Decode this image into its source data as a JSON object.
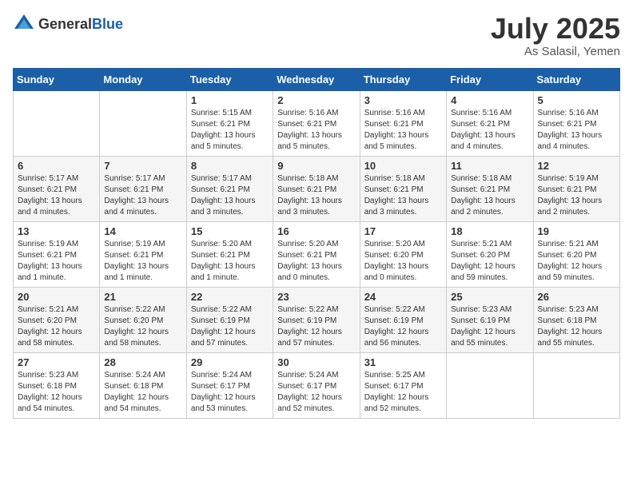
{
  "logo": {
    "general": "General",
    "blue": "Blue"
  },
  "header": {
    "month": "July 2025",
    "location": "As Salasil, Yemen"
  },
  "weekdays": [
    "Sunday",
    "Monday",
    "Tuesday",
    "Wednesday",
    "Thursday",
    "Friday",
    "Saturday"
  ],
  "weeks": [
    [
      null,
      null,
      {
        "day": "1",
        "sunrise": "Sunrise: 5:15 AM",
        "sunset": "Sunset: 6:21 PM",
        "daylight": "Daylight: 13 hours and 5 minutes."
      },
      {
        "day": "2",
        "sunrise": "Sunrise: 5:16 AM",
        "sunset": "Sunset: 6:21 PM",
        "daylight": "Daylight: 13 hours and 5 minutes."
      },
      {
        "day": "3",
        "sunrise": "Sunrise: 5:16 AM",
        "sunset": "Sunset: 6:21 PM",
        "daylight": "Daylight: 13 hours and 5 minutes."
      },
      {
        "day": "4",
        "sunrise": "Sunrise: 5:16 AM",
        "sunset": "Sunset: 6:21 PM",
        "daylight": "Daylight: 13 hours and 4 minutes."
      },
      {
        "day": "5",
        "sunrise": "Sunrise: 5:16 AM",
        "sunset": "Sunset: 6:21 PM",
        "daylight": "Daylight: 13 hours and 4 minutes."
      }
    ],
    [
      {
        "day": "6",
        "sunrise": "Sunrise: 5:17 AM",
        "sunset": "Sunset: 6:21 PM",
        "daylight": "Daylight: 13 hours and 4 minutes."
      },
      {
        "day": "7",
        "sunrise": "Sunrise: 5:17 AM",
        "sunset": "Sunset: 6:21 PM",
        "daylight": "Daylight: 13 hours and 4 minutes."
      },
      {
        "day": "8",
        "sunrise": "Sunrise: 5:17 AM",
        "sunset": "Sunset: 6:21 PM",
        "daylight": "Daylight: 13 hours and 3 minutes."
      },
      {
        "day": "9",
        "sunrise": "Sunrise: 5:18 AM",
        "sunset": "Sunset: 6:21 PM",
        "daylight": "Daylight: 13 hours and 3 minutes."
      },
      {
        "day": "10",
        "sunrise": "Sunrise: 5:18 AM",
        "sunset": "Sunset: 6:21 PM",
        "daylight": "Daylight: 13 hours and 3 minutes."
      },
      {
        "day": "11",
        "sunrise": "Sunrise: 5:18 AM",
        "sunset": "Sunset: 6:21 PM",
        "daylight": "Daylight: 13 hours and 2 minutes."
      },
      {
        "day": "12",
        "sunrise": "Sunrise: 5:19 AM",
        "sunset": "Sunset: 6:21 PM",
        "daylight": "Daylight: 13 hours and 2 minutes."
      }
    ],
    [
      {
        "day": "13",
        "sunrise": "Sunrise: 5:19 AM",
        "sunset": "Sunset: 6:21 PM",
        "daylight": "Daylight: 13 hours and 1 minute."
      },
      {
        "day": "14",
        "sunrise": "Sunrise: 5:19 AM",
        "sunset": "Sunset: 6:21 PM",
        "daylight": "Daylight: 13 hours and 1 minute."
      },
      {
        "day": "15",
        "sunrise": "Sunrise: 5:20 AM",
        "sunset": "Sunset: 6:21 PM",
        "daylight": "Daylight: 13 hours and 1 minute."
      },
      {
        "day": "16",
        "sunrise": "Sunrise: 5:20 AM",
        "sunset": "Sunset: 6:21 PM",
        "daylight": "Daylight: 13 hours and 0 minutes."
      },
      {
        "day": "17",
        "sunrise": "Sunrise: 5:20 AM",
        "sunset": "Sunset: 6:20 PM",
        "daylight": "Daylight: 13 hours and 0 minutes."
      },
      {
        "day": "18",
        "sunrise": "Sunrise: 5:21 AM",
        "sunset": "Sunset: 6:20 PM",
        "daylight": "Daylight: 12 hours and 59 minutes."
      },
      {
        "day": "19",
        "sunrise": "Sunrise: 5:21 AM",
        "sunset": "Sunset: 6:20 PM",
        "daylight": "Daylight: 12 hours and 59 minutes."
      }
    ],
    [
      {
        "day": "20",
        "sunrise": "Sunrise: 5:21 AM",
        "sunset": "Sunset: 6:20 PM",
        "daylight": "Daylight: 12 hours and 58 minutes."
      },
      {
        "day": "21",
        "sunrise": "Sunrise: 5:22 AM",
        "sunset": "Sunset: 6:20 PM",
        "daylight": "Daylight: 12 hours and 58 minutes."
      },
      {
        "day": "22",
        "sunrise": "Sunrise: 5:22 AM",
        "sunset": "Sunset: 6:19 PM",
        "daylight": "Daylight: 12 hours and 57 minutes."
      },
      {
        "day": "23",
        "sunrise": "Sunrise: 5:22 AM",
        "sunset": "Sunset: 6:19 PM",
        "daylight": "Daylight: 12 hours and 57 minutes."
      },
      {
        "day": "24",
        "sunrise": "Sunrise: 5:22 AM",
        "sunset": "Sunset: 6:19 PM",
        "daylight": "Daylight: 12 hours and 56 minutes."
      },
      {
        "day": "25",
        "sunrise": "Sunrise: 5:23 AM",
        "sunset": "Sunset: 6:19 PM",
        "daylight": "Daylight: 12 hours and 55 minutes."
      },
      {
        "day": "26",
        "sunrise": "Sunrise: 5:23 AM",
        "sunset": "Sunset: 6:18 PM",
        "daylight": "Daylight: 12 hours and 55 minutes."
      }
    ],
    [
      {
        "day": "27",
        "sunrise": "Sunrise: 5:23 AM",
        "sunset": "Sunset: 6:18 PM",
        "daylight": "Daylight: 12 hours and 54 minutes."
      },
      {
        "day": "28",
        "sunrise": "Sunrise: 5:24 AM",
        "sunset": "Sunset: 6:18 PM",
        "daylight": "Daylight: 12 hours and 54 minutes."
      },
      {
        "day": "29",
        "sunrise": "Sunrise: 5:24 AM",
        "sunset": "Sunset: 6:17 PM",
        "daylight": "Daylight: 12 hours and 53 minutes."
      },
      {
        "day": "30",
        "sunrise": "Sunrise: 5:24 AM",
        "sunset": "Sunset: 6:17 PM",
        "daylight": "Daylight: 12 hours and 52 minutes."
      },
      {
        "day": "31",
        "sunrise": "Sunrise: 5:25 AM",
        "sunset": "Sunset: 6:17 PM",
        "daylight": "Daylight: 12 hours and 52 minutes."
      },
      null,
      null
    ]
  ]
}
